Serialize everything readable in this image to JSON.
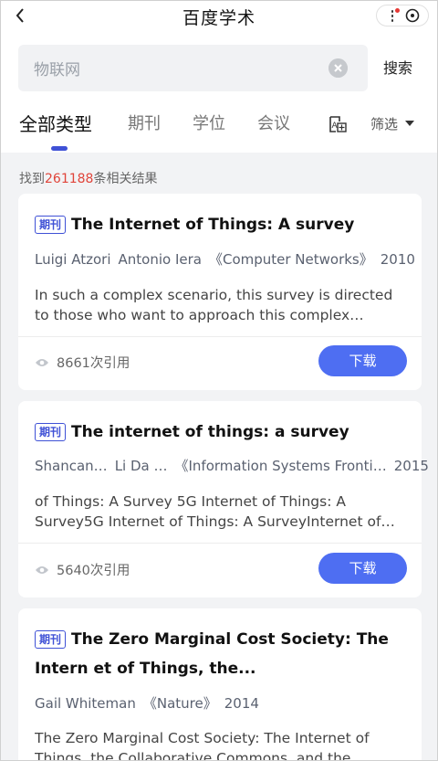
{
  "header": {
    "title": "百度学术"
  },
  "search": {
    "value": "物联网",
    "button_label": "搜索"
  },
  "tabs": [
    {
      "label": "全部类型"
    },
    {
      "label": "期刊"
    },
    {
      "label": "学位"
    },
    {
      "label": "会议"
    }
  ],
  "filter": {
    "label": "筛选"
  },
  "results": {
    "prefix": "找到",
    "count": "261188",
    "suffix": "条相关结果"
  },
  "colors": {
    "accent": "#4e6ef2",
    "highlight": "#e0443a",
    "indicator": "#3f51d6"
  },
  "cards": [
    {
      "badge": "期刊",
      "title": "The Internet of Things: A survey",
      "authors": [
        "Luigi Atzori",
        "Antonio Iera"
      ],
      "journal": "《Computer Networks》",
      "year": "2010",
      "abstract": "In such a complex scenario, this survey is directed to those who want to approach this complex disciplin…",
      "citations": "8661次引用",
      "download_label": "下载"
    },
    {
      "badge": "期刊",
      "title": "The internet of things: a survey",
      "authors": [
        "Shancan…",
        "Li Da …"
      ],
      "journal": "《Information Systems Fronti…",
      "year": "2015",
      "abstract": "of Things: A Survey 5G Internet of Things: A Survey5G Internet of Things: A SurveyInternet of…",
      "citations": "5640次引用",
      "download_label": "下载"
    },
    {
      "badge": "期刊",
      "title": "The Zero Marginal Cost Society: The Intern et of Things, the...",
      "authors": [
        "Gail Whiteman"
      ],
      "journal": "《Nature》",
      "year": "2014",
      "abstract": "The Zero Marginal Cost Society: The Internet of Things, the Collaborative Commons, and the Eclips…"
    }
  ]
}
